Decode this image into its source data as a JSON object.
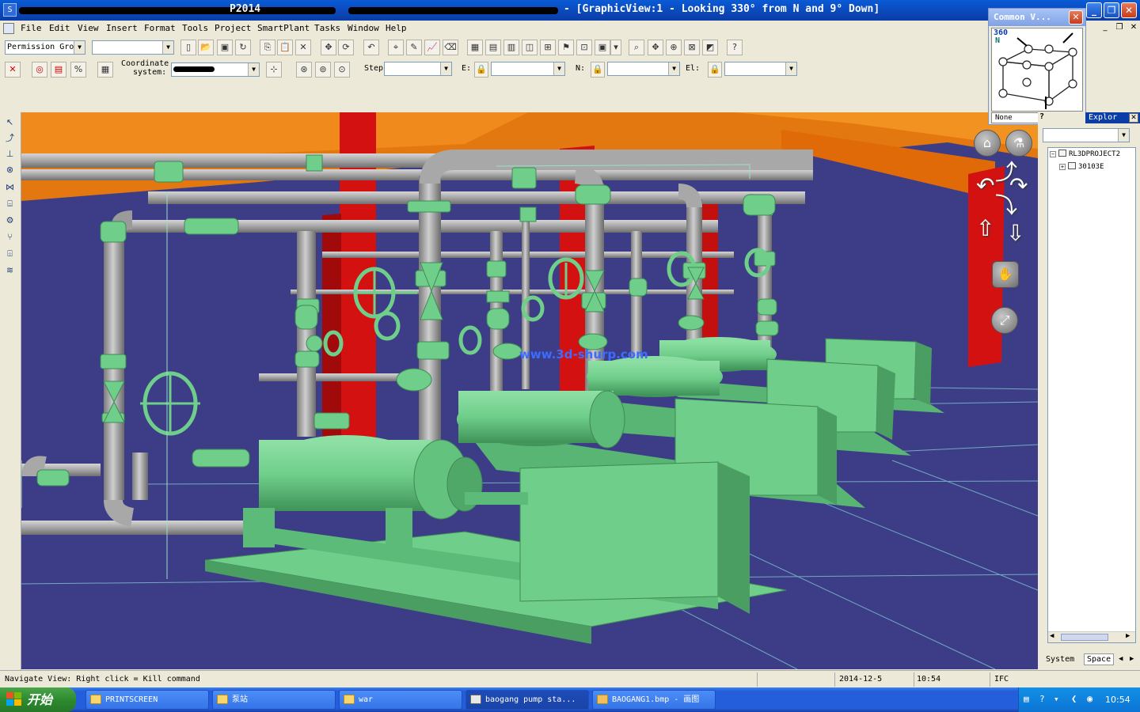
{
  "window": {
    "title_visible": "- [GraphicView:1 - Looking 330° from N and 9° Down]",
    "title_partial": "P2014",
    "min_symbol": "_",
    "max_symbol": "❐",
    "close_symbol": "✕"
  },
  "menu": {
    "items": [
      "File",
      "Edit",
      "View",
      "Insert",
      "Format",
      "Tools",
      "Project",
      "SmartPlant",
      "Tasks",
      "Window",
      "Help"
    ],
    "mdi_min": "_",
    "mdi_restore": "❐",
    "mdi_close": "✕"
  },
  "toolbar1": {
    "permission_group": "Permission Gro",
    "blank_combo": ""
  },
  "toolbar2": {
    "coordinate_label_1": "Coordinate",
    "coordinate_label_2": "system:",
    "step_label": "Step:",
    "e_label": "E:",
    "n_label": "N:",
    "el_label": "El:",
    "step_value": "",
    "e_value": "",
    "n_value": "",
    "el_value": ""
  },
  "common_views": {
    "title": "Common V...",
    "close": "✕",
    "orbit_label": "360",
    "north_label": "N",
    "view_name": "None"
  },
  "explorer": {
    "title": "Explor",
    "close": "✕",
    "help_symbol": "?",
    "tree_root": "RL3DPROJECT2",
    "tree_child": "30103E",
    "tab_system": "System",
    "tab_space": "Space"
  },
  "viewport": {
    "watermark": "www.3d-shurp.com",
    "background_color": "#3d3d87",
    "equipment_color": "#6fce8a",
    "pipe_color": "#a8a8a8",
    "steel_orange": "#e07a10",
    "column_red": "#d41010"
  },
  "statusbar": {
    "message": "Navigate View: Right click = Kill command",
    "date": "2014-12-5",
    "time": "10:54",
    "ifc": "IFC"
  },
  "taskbar": {
    "start_label": "开始",
    "items": [
      {
        "label": "PRINTSCREEN"
      },
      {
        "label": "泵站"
      },
      {
        "label": "war"
      },
      {
        "label": "baogang pump sta..."
      },
      {
        "label": "BAOGANG1.bmp - 画图"
      }
    ],
    "clock": "10:54"
  }
}
